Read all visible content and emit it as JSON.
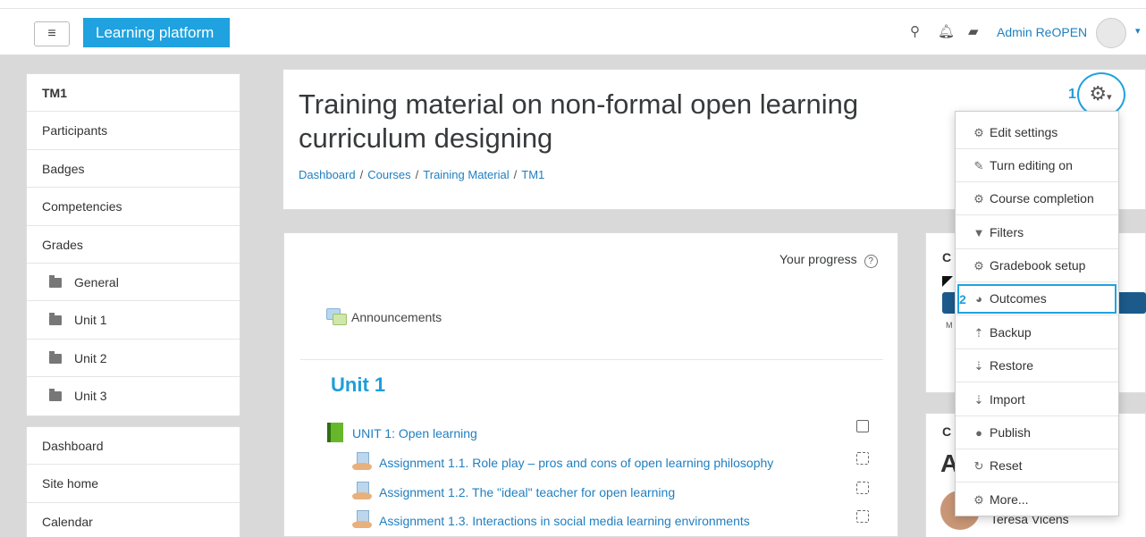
{
  "topbar": {
    "menu_icon": "hamburger-icon",
    "brand": "Learning platform",
    "icons": [
      "search-icon",
      "bell-icon",
      "message-icon"
    ],
    "username": "Admin ReOPEN"
  },
  "sidebar": {
    "course_nav": [
      {
        "label": "TM1",
        "icon": null
      },
      {
        "label": "Participants",
        "icon": null
      },
      {
        "label": "Badges",
        "icon": null
      },
      {
        "label": "Competencies",
        "icon": null
      },
      {
        "label": "Grades",
        "icon": null
      },
      {
        "label": "General",
        "icon": "folder-icon"
      },
      {
        "label": "Unit 1",
        "icon": "folder-icon"
      },
      {
        "label": "Unit 2",
        "icon": "folder-icon"
      },
      {
        "label": "Unit 3",
        "icon": "folder-icon"
      }
    ],
    "site_nav": [
      {
        "label": "Dashboard"
      },
      {
        "label": "Site home"
      },
      {
        "label": "Calendar"
      }
    ]
  },
  "header": {
    "title": "Training material on non-formal open learning curriculum designing",
    "breadcrumb": [
      "Dashboard",
      "Courses",
      "Training Material",
      "TM1"
    ]
  },
  "content": {
    "progress_label": "Your progress",
    "announcements": "Announcements",
    "unit_title": "Unit 1",
    "activities": [
      {
        "label": "UNIT 1: Open learning",
        "icon": "book-icon"
      },
      {
        "label": "Assignment 1.1. Role play – pros and cons of open learning philosophy",
        "icon": "assignment-icon"
      },
      {
        "label": "Assignment 1.2. The \"ideal\" teacher for open learning",
        "icon": "assignment-icon"
      },
      {
        "label": "Assignment 1.3. Interactions in social media learning environments",
        "icon": "assignment-icon"
      }
    ]
  },
  "right_blocks": {
    "block1_partial": "C",
    "block1_small": "M",
    "block2_partial": "C",
    "block2_big": "A",
    "person_name": "Teresa Vicens"
  },
  "settings_menu": {
    "callout_1": "1",
    "callout_2": "2",
    "items": [
      {
        "label": "Edit settings",
        "icon": "gear-icon"
      },
      {
        "label": "Turn editing on",
        "icon": "pencil-icon"
      },
      {
        "label": "Course completion",
        "icon": "gear-icon"
      },
      {
        "label": "Filters",
        "icon": "filter-icon"
      },
      {
        "label": "Gradebook setup",
        "icon": "gear-icon"
      },
      {
        "label": "Outcomes",
        "icon": "outcomes-icon"
      },
      {
        "label": "Backup",
        "icon": "upload-icon"
      },
      {
        "label": "Restore",
        "icon": "download-icon"
      },
      {
        "label": "Import",
        "icon": "download-icon"
      },
      {
        "label": "Publish",
        "icon": "globe-icon"
      },
      {
        "label": "Reset",
        "icon": "reset-icon"
      },
      {
        "label": "More...",
        "icon": "gear-icon"
      }
    ]
  },
  "colors": {
    "brand": "#1fa2df",
    "link": "#1f7fc1",
    "heading_accent": "#1f9ed8"
  }
}
